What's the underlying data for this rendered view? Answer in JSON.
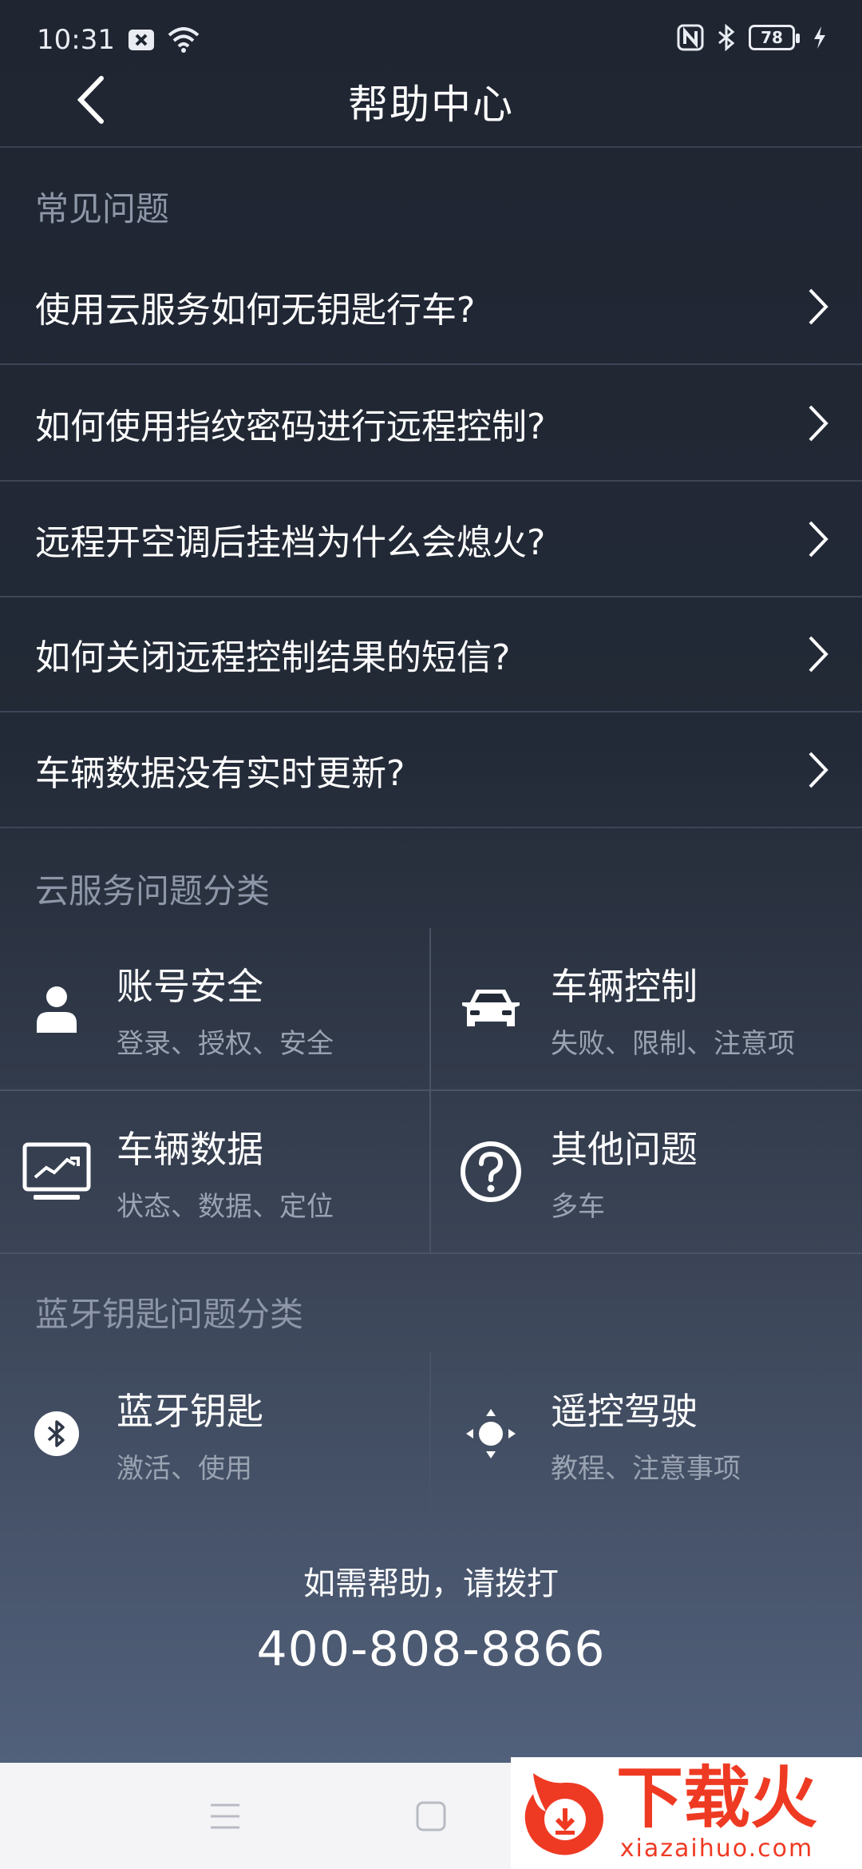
{
  "status_bar": {
    "time": "10:31",
    "battery": "78",
    "icons": [
      "notification-x-icon",
      "wifi-icon",
      "nfc-icon",
      "bluetooth-icon",
      "battery-icon",
      "charging-icon"
    ]
  },
  "header": {
    "title": "帮助中心",
    "back_icon": "chevron-left-icon"
  },
  "faq": {
    "section_title": "常见问题",
    "items": [
      {
        "label": "使用云服务如何无钥匙行车?"
      },
      {
        "label": "如何使用指纹密码进行远程控制?"
      },
      {
        "label": "远程开空调后挂档为什么会熄火?"
      },
      {
        "label": "如何关闭远程控制结果的短信?"
      },
      {
        "label": "车辆数据没有实时更新?"
      }
    ]
  },
  "cloud_categories": {
    "section_title": "云服务问题分类",
    "items": [
      {
        "title": "账号安全",
        "subtitle": "登录、授权、安全",
        "icon": "user-icon"
      },
      {
        "title": "车辆控制",
        "subtitle": "失败、限制、注意项",
        "icon": "car-icon"
      },
      {
        "title": "车辆数据",
        "subtitle": "状态、数据、定位",
        "icon": "monitor-chart-icon"
      },
      {
        "title": "其他问题",
        "subtitle": "多车",
        "icon": "question-circle-icon"
      }
    ]
  },
  "bluetooth_categories": {
    "section_title": "蓝牙钥匙问题分类",
    "items": [
      {
        "title": "蓝牙钥匙",
        "subtitle": "激活、使用",
        "icon": "bluetooth-circle-icon"
      },
      {
        "title": "遥控驾驶",
        "subtitle": "教程、注意事项",
        "icon": "remote-drive-icon"
      }
    ]
  },
  "help": {
    "text": "如需帮助，请拨打",
    "phone": "400-808-8866"
  },
  "watermark": {
    "cn": "下载火",
    "en": "xiazaihuo.com"
  },
  "colors": {
    "accent_watermark": "#ef3a23",
    "background_top": "#1f2531",
    "background_bottom": "#566683"
  }
}
